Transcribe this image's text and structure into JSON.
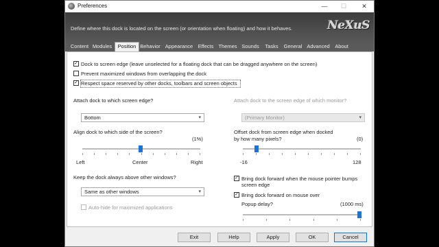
{
  "window": {
    "title": "Preferences"
  },
  "banner": {
    "description": "Define where this dock is located on the screen (or orientation when floating) and how it behaves.",
    "logo": "NeXuS"
  },
  "tabs": [
    "Content",
    "Modules",
    "Position",
    "Behavior",
    "Appearance",
    "Effects",
    "Themes",
    "Sounds",
    "Tasks",
    "General",
    "Advanced",
    "About"
  ],
  "active_tab": "Position",
  "options": {
    "dock_edge": {
      "label": "Dock to screen edge (leave unselected for a floating dock that can be dragged anywhere on the screen)",
      "checked": true
    },
    "prevent_max": {
      "label": "Prevent maximized windows from overlapping the dock",
      "checked": false
    },
    "respect_space": {
      "label": "Respect space reserved by other docks, toolbars and screen objects",
      "checked": true
    }
  },
  "attach": {
    "label": "Attach dock to which screen edge?",
    "value": "Bottom"
  },
  "monitor": {
    "label": "Attach dock to the screen edge of which monitor?",
    "value": "(Primary Monitor)"
  },
  "align": {
    "label": "Align dock to which side of the screen?",
    "value_text": "(1%)",
    "value": 1,
    "left": "Left",
    "center": "Center",
    "right": "Right"
  },
  "offset": {
    "label_line1": "Offset dock from screen edge when docked",
    "label_line2": "by how many pixels?",
    "value_text": "(0)",
    "value": 0,
    "min": "-16",
    "max": "128"
  },
  "above": {
    "label": "Keep the dock always above other windows?",
    "value": "Same as other windows"
  },
  "autohide": {
    "label": "Auto-hide for maximized applications",
    "checked": false
  },
  "bring_forward_bump": {
    "label_line1": "Bring dock forward when the mouse pointer bumps",
    "label_line2": "screen edge",
    "checked": true
  },
  "bring_forward_mouse": {
    "label": "Bring dock forward on mouse over",
    "checked": true
  },
  "popup_delay": {
    "label": "Popup delay?",
    "value_text": "(1000 ms)",
    "value_ms": 1000
  },
  "buttons": {
    "exit": "Exit",
    "help": "Help",
    "apply": "Apply",
    "ok": "OK",
    "cancel": "Cancel"
  },
  "icons": {
    "minimize": "—",
    "maximize": "☐",
    "close": "✕",
    "check": "✓",
    "caret": "▾"
  }
}
